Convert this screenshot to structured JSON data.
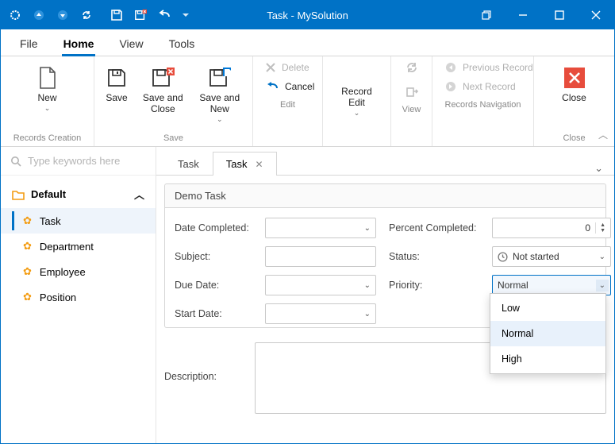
{
  "title": "Task - MySolution",
  "menutabs": {
    "file": "File",
    "home": "Home",
    "view": "View",
    "tools": "Tools"
  },
  "ribbon": {
    "records_creation": {
      "label": "Records Creation",
      "new": "New"
    },
    "save": {
      "label": "Save",
      "save": "Save",
      "save_close": "Save and\nClose",
      "save_new": "Save and New"
    },
    "edit": {
      "label": "Edit",
      "delete": "Delete",
      "cancel": "Cancel"
    },
    "record_edit": "Record\nEdit",
    "view": {
      "label": "View"
    },
    "nav": {
      "label": "Records Navigation",
      "prev": "Previous Record",
      "next": "Next Record"
    },
    "close": {
      "label": "Close",
      "btn": "Close"
    }
  },
  "search_placeholder": "Type keywords here",
  "sidebar": {
    "group": "Default",
    "items": [
      "Task",
      "Department",
      "Employee",
      "Position"
    ]
  },
  "doctabs": {
    "tab1": "Task",
    "tab2": "Task"
  },
  "form": {
    "title": "Demo Task",
    "date_completed": "Date Completed:",
    "percent_completed": "Percent Completed:",
    "percent_value": "0",
    "subject": "Subject:",
    "status": "Status:",
    "status_value": "Not started",
    "due_date": "Due Date:",
    "priority": "Priority:",
    "priority_value": "Normal",
    "start_date": "Start Date:",
    "description": "Description:"
  },
  "priority_options": {
    "low": "Low",
    "normal": "Normal",
    "high": "High"
  }
}
